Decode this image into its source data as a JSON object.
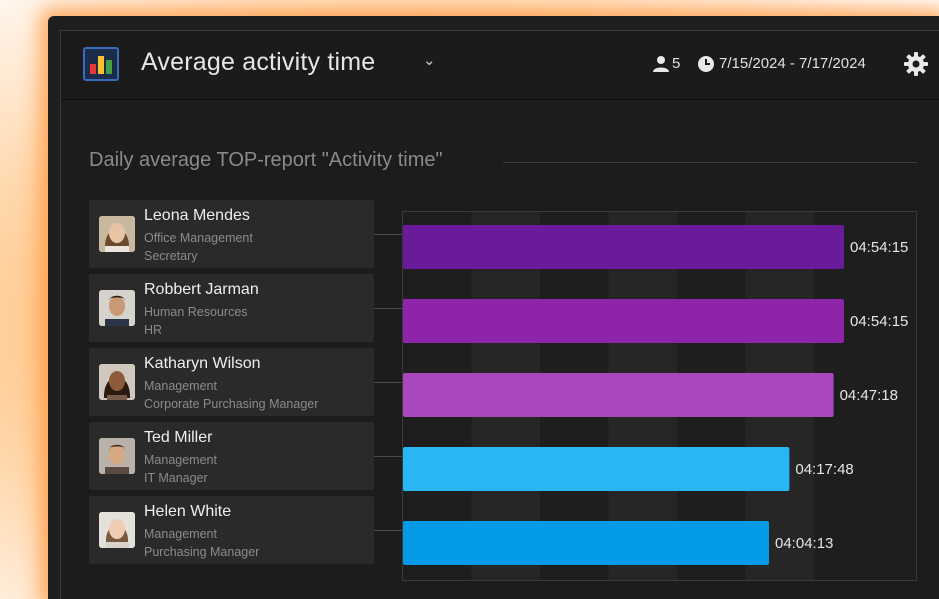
{
  "header": {
    "title": "Average activity time",
    "users_count": "5",
    "date_range": "7/15/2024 - 7/17/2024",
    "icons": {
      "app": "bar-chart-app-icon",
      "dropdown": "chevron-down-icon",
      "users": "user-icon",
      "clock": "clock-icon",
      "settings": "gear-icon"
    }
  },
  "section": {
    "title": "Daily average TOP-report \"Activity time\""
  },
  "people": [
    {
      "name": "Leona Mendes",
      "department": "Office Management",
      "role": "Secretary"
    },
    {
      "name": "Robbert Jarman",
      "department": "Human Resources",
      "role": "HR"
    },
    {
      "name": "Katharyn Wilson",
      "department": "Management",
      "role": "Corporate Purchasing Manager"
    },
    {
      "name": "Ted Miller",
      "department": "Management",
      "role": "IT Manager"
    },
    {
      "name": "Helen White",
      "department": "Management",
      "role": "Purchasing Manager"
    }
  ],
  "colors": {
    "bar_colors": [
      "#6a1b9a",
      "#8e24aa",
      "#ab47bc",
      "#29b6f6",
      "#039be5"
    ],
    "glow": "#ff9a3c",
    "panel_bg": "#1c1c1c"
  },
  "chart_data": {
    "type": "bar",
    "orientation": "horizontal",
    "categories": [
      "Leona Mendes",
      "Robbert Jarman",
      "Katharyn Wilson",
      "Ted Miller",
      "Helen White"
    ],
    "values": [
      17655,
      17655,
      17238,
      15468,
      14653
    ],
    "value_labels": [
      "04:54:15",
      "04:54:15",
      "04:47:18",
      "04:17:48",
      "04:04:13"
    ],
    "xlim": [
      0,
      18000
    ],
    "grid": "vertical bands",
    "title": "Daily average TOP-report \"Activity time\""
  }
}
